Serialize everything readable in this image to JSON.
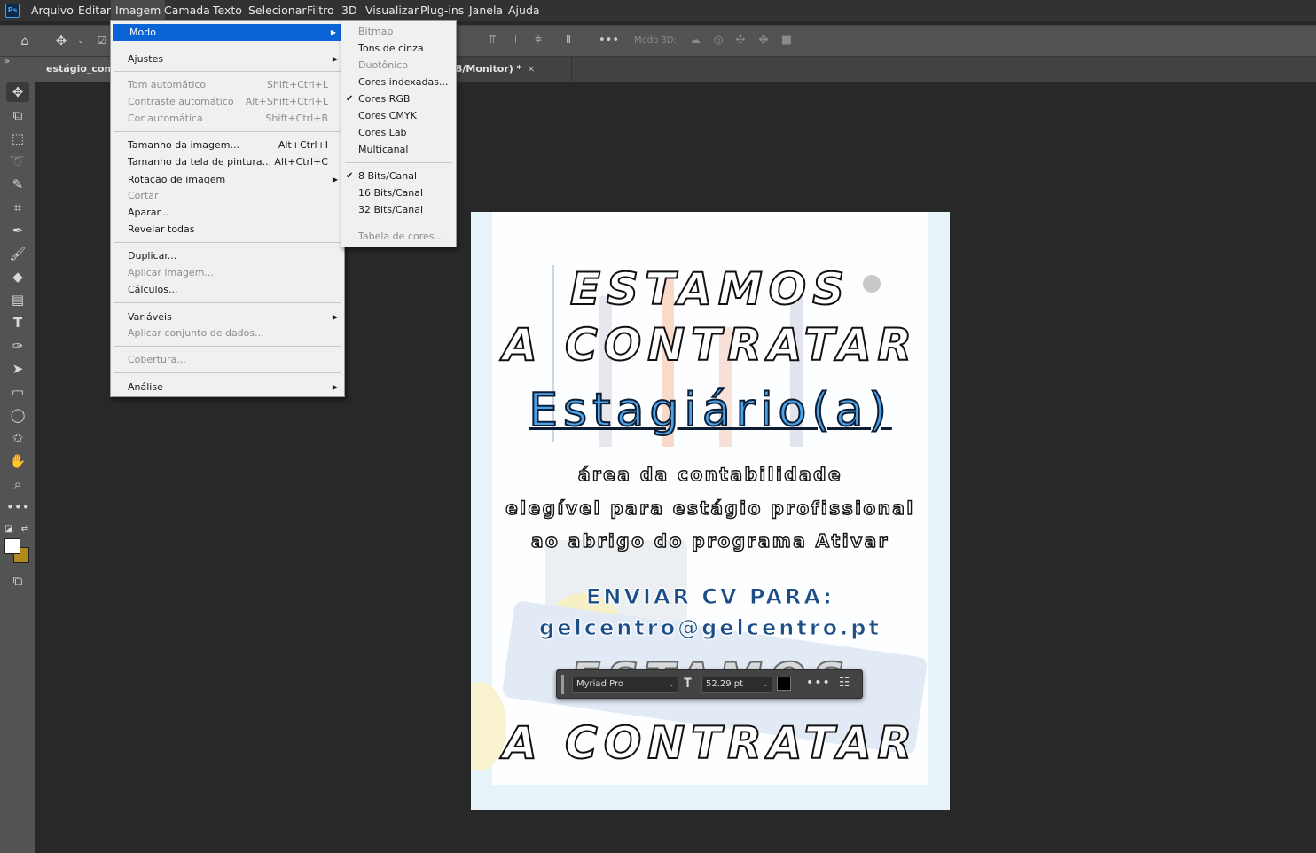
{
  "menubar": {
    "logo": "Ps",
    "items": [
      "Arquivo",
      "Editar",
      "Imagem",
      "Camada",
      "Texto",
      "Selecionar",
      "Filtro",
      "3D",
      "Visualizar",
      "Plug-ins",
      "Janela",
      "Ajuda"
    ]
  },
  "optionsbar": {
    "mode3d_label": "Modo 3D:"
  },
  "tabs": {
    "tab1": "estágio_conta",
    "tab2": "B/Monitor) *",
    "close": "×"
  },
  "image_menu": {
    "modo": "Modo",
    "ajustes": "Ajustes",
    "tom_auto": "Tom automático",
    "tom_auto_sc": "Shift+Ctrl+L",
    "contraste_auto": "Contraste automático",
    "contraste_auto_sc": "Alt+Shift+Ctrl+L",
    "cor_auto": "Cor automática",
    "cor_auto_sc": "Shift+Ctrl+B",
    "tamanho_imagem": "Tamanho da imagem...",
    "tamanho_imagem_sc": "Alt+Ctrl+I",
    "tamanho_tela": "Tamanho da tela de pintura...",
    "tamanho_tela_sc": "Alt+Ctrl+C",
    "rotacao": "Rotação de imagem",
    "cortar": "Cortar",
    "aparar": "Aparar...",
    "revelar": "Revelar todas",
    "duplicar": "Duplicar...",
    "aplicar_imagem": "Aplicar imagem...",
    "calculos": "Cálculos...",
    "variaveis": "Variáveis",
    "aplicar_conjunto": "Aplicar conjunto de dados...",
    "cobertura": "Cobertura...",
    "analise": "Análise"
  },
  "mode_menu": {
    "bitmap": "Bitmap",
    "tons_cinza": "Tons de cinza",
    "duotonico": "Duotônico",
    "cores_indexadas": "Cores indexadas...",
    "cores_rgb": "Cores RGB",
    "cores_cmyk": "Cores CMYK",
    "cores_lab": "Cores Lab",
    "multicanal": "Multicanal",
    "bits8": "8 Bits/Canal",
    "bits16": "16 Bits/Canal",
    "bits32": "32 Bits/Canal",
    "tabela_cores": "Tabela de cores...",
    "check": "✔"
  },
  "document": {
    "line1": "ESTAMOS",
    "line2": "A CONTRATAR",
    "title": "Estagiário(a)",
    "body1": "área da contabilidade",
    "body2": "elegível para estágio profissional",
    "body3": "ao abrigo do programa Ativar",
    "cv_label": "ENVIAR CV PARA:",
    "email": "gelcentro@gelcentro.pt",
    "line1_repeat": "ESTAMOS",
    "line2_repeat": "A CONTRATAR"
  },
  "text_toolbar": {
    "font": "Myriad Pro",
    "size": "52.29 pt",
    "color": "#000000"
  },
  "colors": {
    "accent": "#0a64d6",
    "foreground_swatch": "#ffffff",
    "background_swatch": "#b08a1b"
  }
}
